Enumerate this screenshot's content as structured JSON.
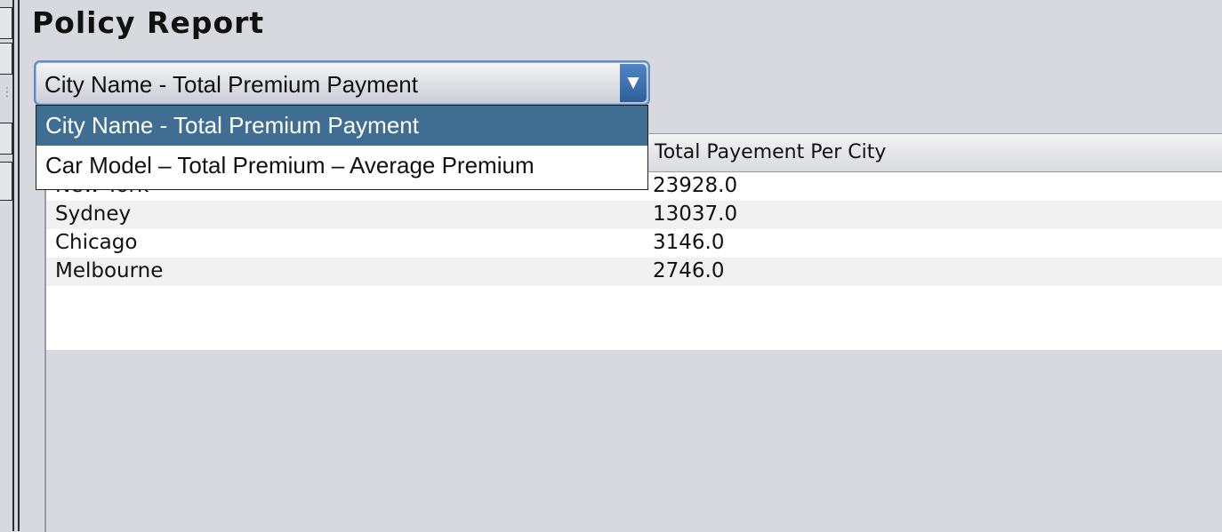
{
  "page": {
    "title": "Policy Report"
  },
  "report_selector": {
    "selected_value": "City Name - Total Premium Payment",
    "options": [
      "City Name - Total Premium Payment",
      "Car Model – Total Premium – Average Premium"
    ],
    "expanded": true,
    "highlighted_index": 0,
    "arrow_icon": "triangle-down-icon"
  },
  "table": {
    "columns": [
      "",
      "Total Payement Per City"
    ],
    "rows": [
      {
        "city": "New York",
        "total": "23928.0"
      },
      {
        "city": "Sydney",
        "total": "13037.0"
      },
      {
        "city": "Chicago",
        "total": "3146.0"
      },
      {
        "city": "Melbourne",
        "total": "2746.0"
      }
    ]
  },
  "colors": {
    "background": "#d7d9df",
    "selection": "#3f6e92",
    "combo_button": "#3e73b3"
  }
}
